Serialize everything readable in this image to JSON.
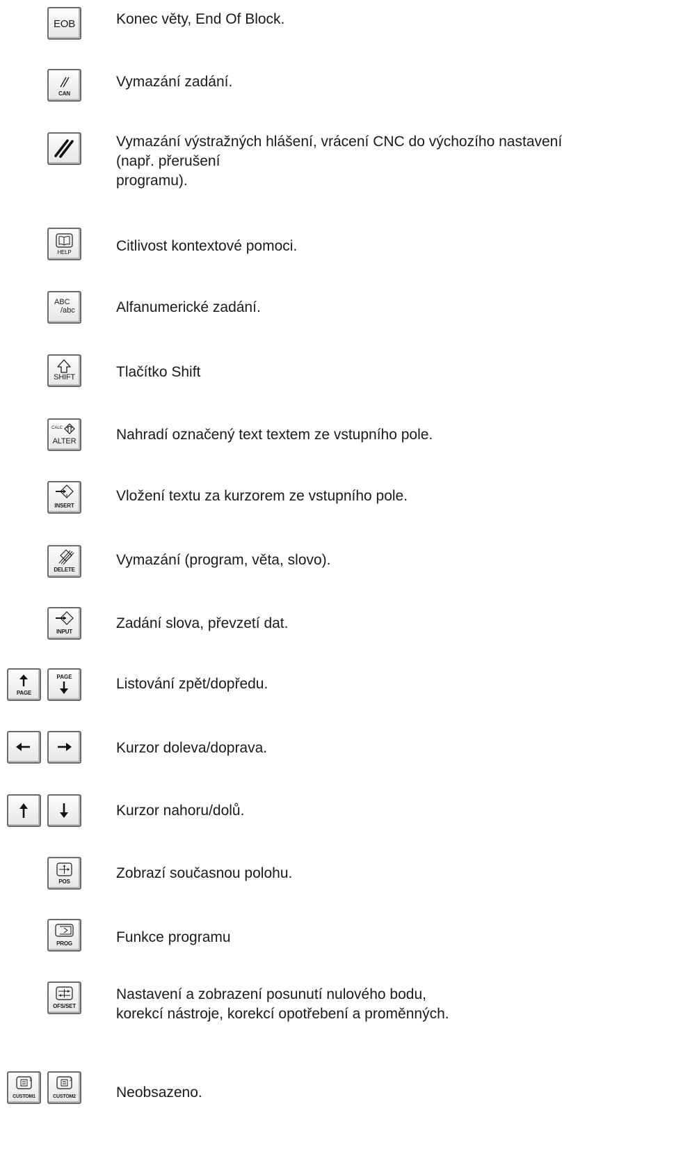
{
  "keys": [
    {
      "labels": [
        "EOB"
      ],
      "icon": "eob-key-icon",
      "description": "Konec věty, End Of Block."
    },
    {
      "labels": [
        "CAN"
      ],
      "icon": "double-slash-icon",
      "description": "Vymazání zadání."
    },
    {
      "labels": [
        ""
      ],
      "icon": "reset-double-slash-icon",
      "description": "Vymazání výstražných hlášení, vrácení CNC do výchozího nastavení\n             (např. přerušení\nprogramu)."
    },
    {
      "labels": [
        "HELP"
      ],
      "icon": "book-icon",
      "description": "Citlivost kontextové pomoci."
    },
    {
      "labels": [
        "ABC/abc"
      ],
      "icon": "abc-icon",
      "abc_top": "ABC",
      "abc_bottom": "/abc",
      "description": "Alfanumerické zadání."
    },
    {
      "labels": [
        "SHIFT"
      ],
      "icon": "shift-arrow-icon",
      "description": "Tlačítko Shift"
    },
    {
      "labels": [
        "ALTER"
      ],
      "icon": "alter-icon",
      "calc": "CALC",
      "description": "Nahradí označený text textem ze vstupního pole."
    },
    {
      "labels": [
        "INSERT"
      ],
      "icon": "insert-icon",
      "description": "Vložení textu za kurzorem ze vstupního pole."
    },
    {
      "labels": [
        "DELETE"
      ],
      "icon": "delete-icon",
      "description": "Vymazání (program, věta, slovo)."
    },
    {
      "labels": [
        "INPUT"
      ],
      "icon": "input-icon",
      "description": "Zadání slova, převzetí dat."
    },
    {
      "labels": [
        "PAGE",
        "PAGE"
      ],
      "icon": "page-arrows-icon",
      "description": "Listování zpět/dopředu."
    },
    {
      "labels": [
        "",
        ""
      ],
      "icon": "left-right-arrows-icon",
      "description": "Kurzor doleva/doprava."
    },
    {
      "labels": [
        "",
        ""
      ],
      "icon": "up-down-arrows-icon",
      "description": "Kurzor nahoru/dolů."
    },
    {
      "labels": [
        "POS"
      ],
      "icon": "position-icon",
      "description": "Zobrazí současnou polohu."
    },
    {
      "labels": [
        "PROG"
      ],
      "icon": "program-icon",
      "description": "Funkce programu"
    },
    {
      "labels": [
        "OFS/SET"
      ],
      "icon": "offset-icon",
      "description": "Nastavení a zobrazení posunutí nulového bodu,\nkorekcí nástroje, korekcí opotřebení a proměnných."
    },
    {
      "labels": [
        "CUSTOM1",
        "CUSTOM2"
      ],
      "icon": "custom-icon",
      "description": "Neobsazeno."
    }
  ]
}
